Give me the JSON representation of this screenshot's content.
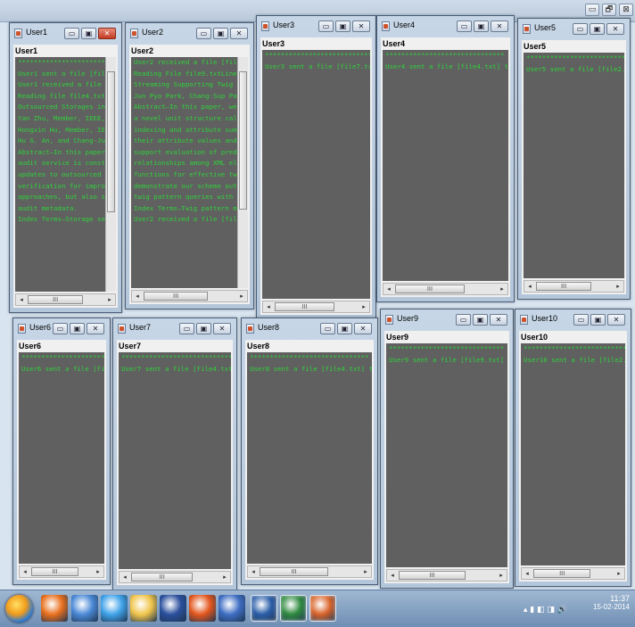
{
  "desktop_controls": [
    "▭",
    "🗗",
    "⊠"
  ],
  "windows": [
    {
      "id": "w1",
      "title": "User1",
      "label": "User1",
      "active": true,
      "vscroll": true,
      "lines": [
        "***********************",
        "User1 sent a file [file",
        "User1 received a file [",
        "Reading file file4.txt",
        "Outsourced Storages in C",
        "Yan Zhu, Member, IEEE, G",
        "Hongxin Hu, Member, IEEE",
        "Hu G. An, and Chang-Jun",
        "Abstract—In this paper,",
        "audit service is constru",
        "updates to outsourced da",
        "verification for improvi",
        "approaches, but also sho",
        "audit metadata.",
        "Index Terms—Storage secu"
      ]
    },
    {
      "id": "w2",
      "title": "User2",
      "label": "User2",
      "active": false,
      "vscroll": true,
      "lines": [
        "User2 received a file [file4.",
        "Reading File file9.txtLineage",
        "Streaming Supporting Twig Patt",
        "Jun Pyo Park, Chang-Sup Park,",
        "Abstract—In this paper, we pr",
        "a novel unit structure called",
        "indexing and attribute summari",
        "their attribute values and tex",
        "support evaluation of predica",
        "relationships among XML elemen",
        "functions for effective twig p",
        "demonstrate our scheme outperf",
        "twig pattern queries with pred",
        "Index Terms—Twig pattern match",
        "User2 received a file [file5."
      ]
    },
    {
      "id": "w3",
      "title": "User3",
      "label": "User3",
      "active": false,
      "vscroll": false,
      "lines": [
        "***************************",
        "User3 sent a file [file7.txt"
      ]
    },
    {
      "id": "w4",
      "title": "User4",
      "label": "User4",
      "active": false,
      "vscroll": false,
      "lines": [
        "******************************",
        "User4 sent a file [file4.txt] to"
      ]
    },
    {
      "id": "w5",
      "title": "User5",
      "label": "User5",
      "active": false,
      "vscroll": false,
      "lines": [
        "*****************************",
        "User5 sent a file [file2.txt]"
      ]
    },
    {
      "id": "w6",
      "title": "User6",
      "label": "User6",
      "active": false,
      "vscroll": false,
      "lines": [
        "**********************",
        "User6 sent a file [fil"
      ]
    },
    {
      "id": "w7",
      "title": "User7",
      "label": "User7",
      "active": false,
      "vscroll": false,
      "lines": [
        "****************************",
        "User7 sent a file [file4.txt]"
      ]
    },
    {
      "id": "w8",
      "title": "User8",
      "label": "User8",
      "active": false,
      "vscroll": false,
      "lines": [
        "******************************",
        "User8 sent a file [file4.txt] to"
      ]
    },
    {
      "id": "w9",
      "title": "User9",
      "label": "User9",
      "active": false,
      "vscroll": false,
      "lines": [
        "*****************************",
        "User9 sent a file [file9.txt] t"
      ]
    },
    {
      "id": "w10",
      "title": "User10",
      "label": "User10",
      "active": false,
      "vscroll": false,
      "lines": [
        "***************************",
        "User10 sent a file [file2.tx"
      ]
    }
  ],
  "scroll_thumb_glyph": "III",
  "taskbar": {
    "icons": [
      {
        "name": "media-player-icon",
        "color": "#e86f1c"
      },
      {
        "name": "network-icon",
        "color": "#4b89d6"
      },
      {
        "name": "internet-explorer-icon",
        "color": "#3fa2e8"
      },
      {
        "name": "file-explorer-icon",
        "color": "#f0c44a"
      },
      {
        "name": "messenger-icon",
        "color": "#2a4f9c"
      },
      {
        "name": "firefox-icon",
        "color": "#e2561d"
      },
      {
        "name": "word-icon",
        "color": "#3e6dc2"
      },
      {
        "name": "netbeans-icon",
        "color": "#2b5ea8"
      },
      {
        "name": "app-window-icon",
        "color": "#2f8a3f"
      },
      {
        "name": "java-icon",
        "color": "#d9642a"
      }
    ],
    "tray_icons": "▴ ▮ ◧ ◨ 🔊",
    "time": "11:37",
    "date": "15-02-2014"
  }
}
